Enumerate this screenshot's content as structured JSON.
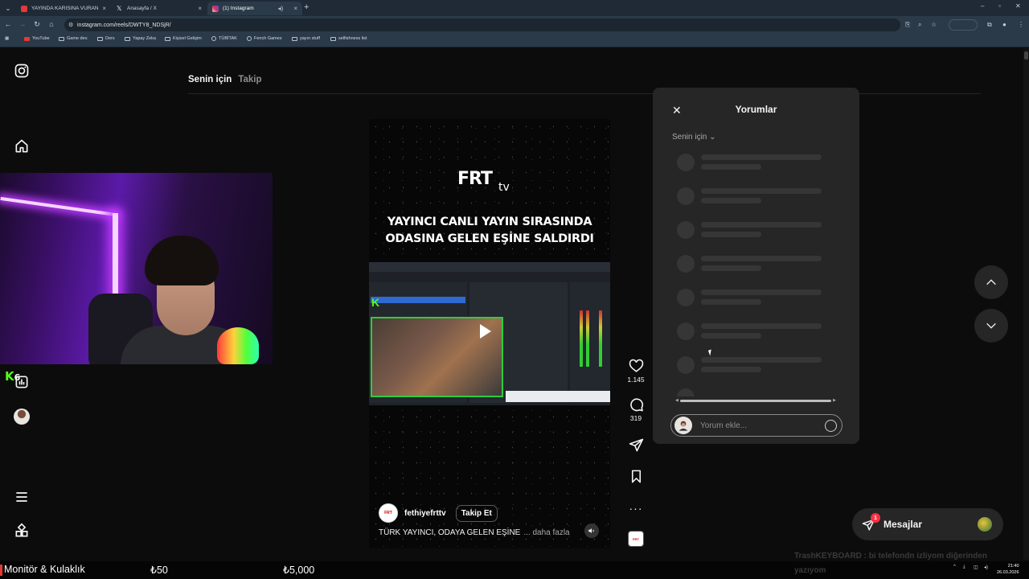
{
  "browser": {
    "tabs": [
      {
        "title": "YAYINDA KARISINA VURAN YA",
        "favicon_color": "#e53935"
      },
      {
        "title": "Anasayfa / X",
        "favicon_color": "#ffffff"
      },
      {
        "title": "(1) Instagram",
        "favicon_color": "#d62976"
      }
    ],
    "url": "instagram.com/reels/DWTY8_NDSjR/",
    "bookmarks": [
      "YouTube",
      "Game dev.",
      "Ders",
      "Yapay Zeka",
      "Kişisel Gelişim",
      "TÜBİTAK",
      "Fench Games",
      "yayın stuff",
      "selfishness list"
    ]
  },
  "feed": {
    "tab_for_you": "Senin için",
    "tab_following": "Takip"
  },
  "reel": {
    "logo_text": "FRT",
    "logo_tv": "tv",
    "headline_line1": "YAYINCI CANLI YAYIN SIRASINDA",
    "headline_line2": "ODASINA GELEN EŞİNE SALDIRDI",
    "username": "fethiyefrttv",
    "follow_label": "Takip Et",
    "caption": "TÜRK YAYINCI, ODAYA GELEN EŞİNE",
    "more_label": "... daha fazla",
    "likes": "1.145",
    "comments_count": "319"
  },
  "comments": {
    "title": "Yorumlar",
    "sort_label": "Senin için",
    "input_placeholder": "Yorum ekle..."
  },
  "messages": {
    "label": "Mesajlar",
    "badge": "1"
  },
  "overlay": {
    "kick_count": "6",
    "product": "Monitör & Kulaklık",
    "price1": "₺50",
    "price2": "₺5,000",
    "ticker": "TrashKEYBOARD : bi telefondn izliyom diğerinden",
    "ticker2": "yazıyom"
  },
  "taskbar": {
    "time": "21:40",
    "date": "26.03.2026"
  },
  "colors": {
    "instagram_bg": "#0c0c0c",
    "panel_bg": "#262626",
    "badge_red": "#ff3040",
    "kick_green": "#53fc18"
  }
}
